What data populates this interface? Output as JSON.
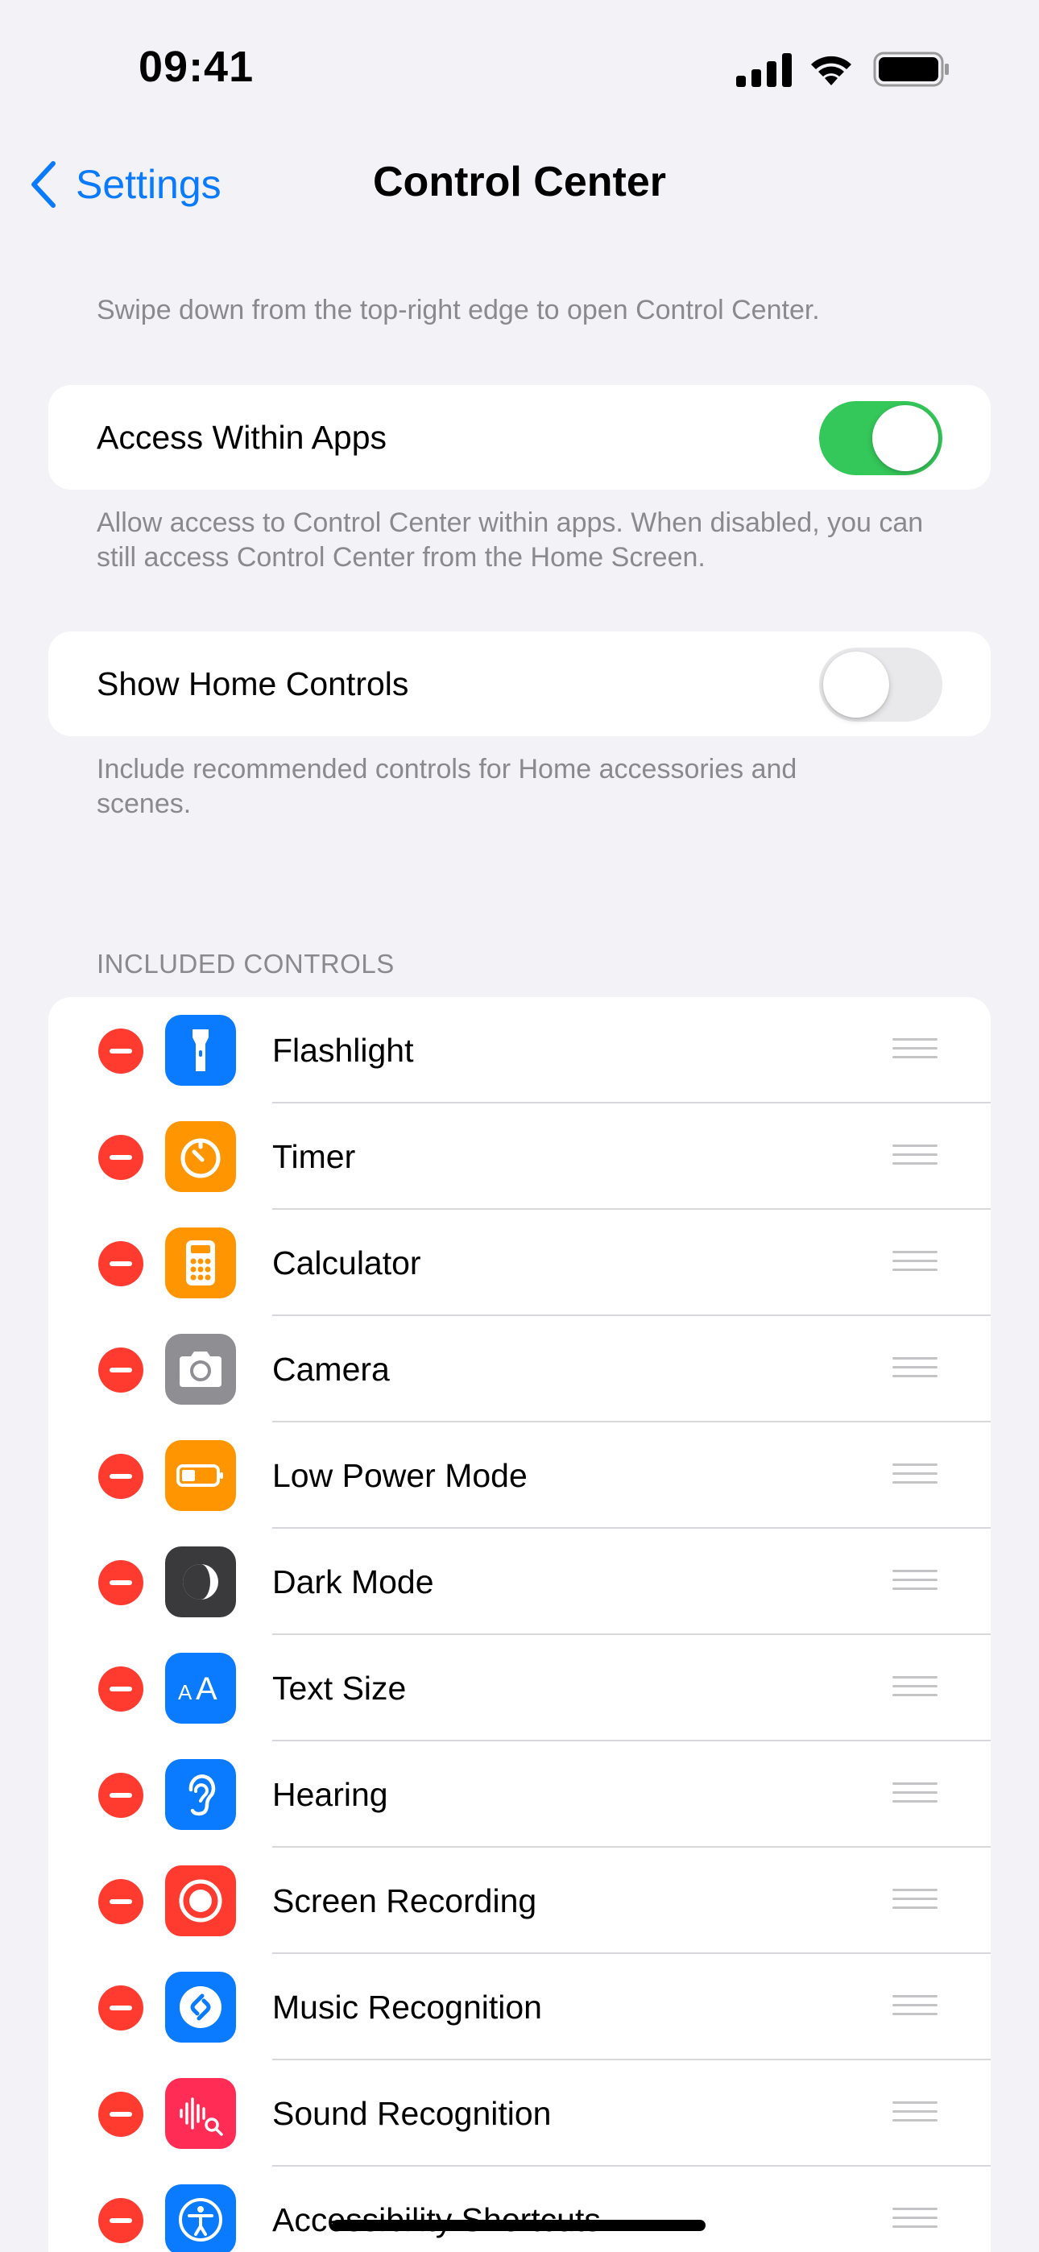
{
  "status_bar": {
    "time": "09:41"
  },
  "nav": {
    "back_label": "Settings",
    "title": "Control Center"
  },
  "intro_text": "Swipe down from the top-right edge to open Control Center.",
  "access_within_apps": {
    "label": "Access Within Apps",
    "enabled": true,
    "footnote": "Allow access to Control Center within apps. When disabled, you can still access Control Center from the Home Screen."
  },
  "show_home_controls": {
    "label": "Show Home Controls",
    "enabled": false,
    "footnote": "Include recommended controls for Home accessories and scenes."
  },
  "included_controls": {
    "header": "INCLUDED CONTROLS",
    "items": [
      {
        "label": "Flashlight",
        "icon": "flashlight-icon",
        "color": "#0a7aff"
      },
      {
        "label": "Timer",
        "icon": "timer-icon",
        "color": "#ff9500"
      },
      {
        "label": "Calculator",
        "icon": "calculator-icon",
        "color": "#ff9500"
      },
      {
        "label": "Camera",
        "icon": "camera-icon",
        "color": "#8e8e93"
      },
      {
        "label": "Low Power Mode",
        "icon": "battery-icon",
        "color": "#ff9500"
      },
      {
        "label": "Dark Mode",
        "icon": "dark-mode-icon",
        "color": "#3a3a3c"
      },
      {
        "label": "Text Size",
        "icon": "text-size-icon",
        "color": "#0a7aff"
      },
      {
        "label": "Hearing",
        "icon": "ear-icon",
        "color": "#0a7aff"
      },
      {
        "label": "Screen Recording",
        "icon": "record-icon",
        "color": "#ff3b30"
      },
      {
        "label": "Music Recognition",
        "icon": "shazam-icon",
        "color": "#0a7aff"
      },
      {
        "label": "Sound Recognition",
        "icon": "sound-recognition-icon",
        "color": "#ff2d55"
      },
      {
        "label": "Accessibility Shortcuts",
        "icon": "accessibility-icon",
        "color": "#0a7aff"
      }
    ]
  }
}
